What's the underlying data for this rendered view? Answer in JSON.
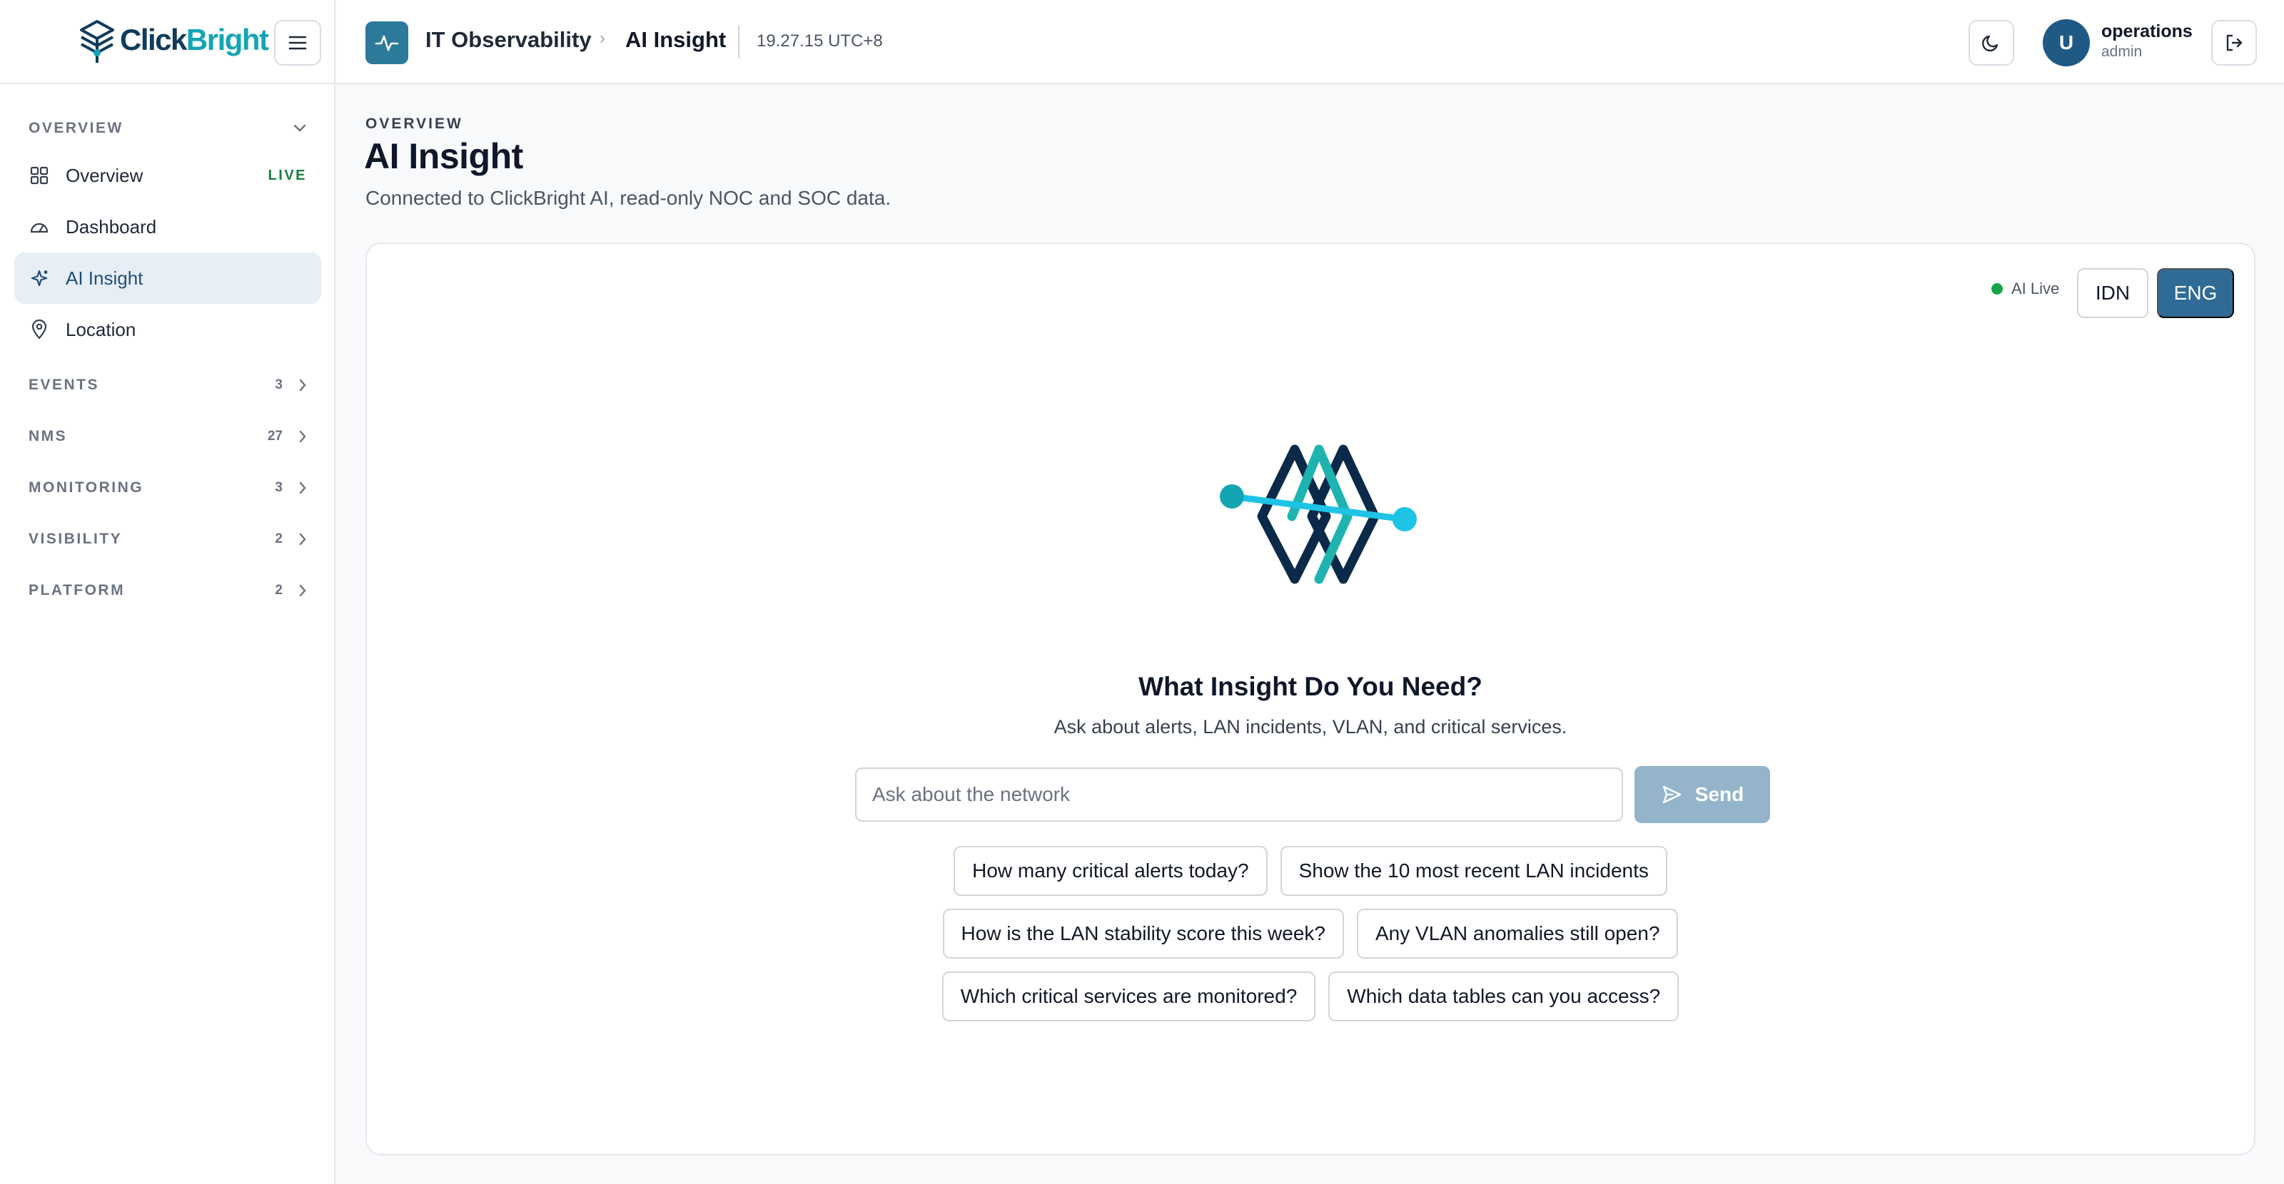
{
  "brand": {
    "name_part1": "Click",
    "name_part2": "Bright"
  },
  "sidebar": {
    "overview_section": "OVERVIEW",
    "items": [
      {
        "label": "Overview",
        "icon": "grid-icon",
        "tag": "LIVE"
      },
      {
        "label": "Dashboard",
        "icon": "gauge-icon"
      },
      {
        "label": "AI Insight",
        "icon": "sparkle-icon",
        "active": true
      },
      {
        "label": "Location",
        "icon": "map-pin-icon"
      }
    ],
    "sections": [
      {
        "label": "EVENTS",
        "count": "3"
      },
      {
        "label": "NMS",
        "count": "27"
      },
      {
        "label": "MONITORING",
        "count": "3"
      },
      {
        "label": "VISIBILITY",
        "count": "2"
      },
      {
        "label": "PLATFORM",
        "count": "2"
      }
    ]
  },
  "header": {
    "app_name": "IT Observability",
    "separator": "›",
    "current_page": "AI Insight",
    "clock": "19.27.15 UTC+8",
    "user": {
      "initial": "U",
      "name": "operations",
      "role": "admin"
    }
  },
  "main": {
    "eyebrow": "OVERVIEW",
    "title": "AI Insight",
    "subtitle": "Connected to ClickBright AI, read-only NOC and SOC data.",
    "status": "AI Live",
    "languages": [
      "IDN",
      "ENG"
    ],
    "selected_language": "ENG",
    "prompt_title": "What Insight Do You Need?",
    "prompt_sub": "Ask about alerts, LAN incidents, VLAN, and critical services.",
    "input_placeholder": "Ask about the network",
    "send_label": "Send",
    "suggestions": [
      "How many critical alerts today?",
      "Show the 10 most recent LAN incidents",
      "How is the LAN stability score this week?",
      "Any VLAN anomalies still open?",
      "Which critical services are monitored?",
      "Which data tables can you access?"
    ]
  },
  "colors": {
    "brand_navy": "#0f3b5c",
    "brand_teal": "#14a5b4",
    "accent": "#2f6b95",
    "live_green": "#16a34a",
    "send_disabled": "#94b4cb"
  }
}
